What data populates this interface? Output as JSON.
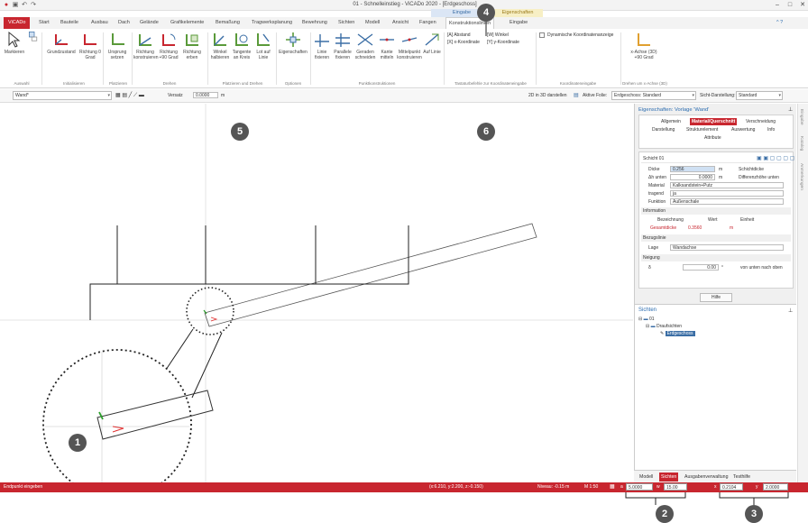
{
  "window": {
    "title": "01 - Schnelleinstieg - ViCADo 2020 - [Erdgeschoss]",
    "context_group_1": "Eingabe",
    "context_group_2": "Eigenschaften"
  },
  "tabs": [
    "ViCADo",
    "Start",
    "Bauteile",
    "Ausbau",
    "Dach",
    "Gelände",
    "Grafikelemente",
    "Bemaßung",
    "Tragwerksplanung",
    "Bewehrung",
    "Sichten",
    "Modell",
    "Ansicht",
    "Fangen",
    "Konstruktionslinien",
    "Eingabe"
  ],
  "ribbon": {
    "auswahl": {
      "markieren": "Markieren",
      "group": "Auswahl"
    },
    "initialisieren": {
      "grundzustand": "Grundzustand",
      "richtung_0": "Richtung 0 Grad",
      "group": "Initialisieren"
    },
    "platzieren": {
      "ursprung": "Ursprung setzen",
      "group": "Platzieren"
    },
    "drehen": {
      "richtung_konstruieren": "Richtung konstruieren",
      "richtung_90": "Richtung +90 Grad",
      "richtung_erben": "Richtung erben",
      "group": "Drehen"
    },
    "platzieren_drehen": {
      "winkel": "Winkel halbieren",
      "tangente": "Tangente an Kreis",
      "lot": "Lot auf Linie",
      "group": "Platzieren und Drehen"
    },
    "optionen": {
      "eigenschaften": "Eigenschaften",
      "group": "Optionen"
    },
    "punkte": {
      "linie": "Linie fixieren",
      "parallele": "Parallele fixieren",
      "geraden": "Geraden schneiden",
      "kante": "Kante mitteln",
      "mittelpunkt": "Mittelpunkt konstruieren",
      "auf_linie": "Auf Linie",
      "group": "Punktkonstruktionen"
    },
    "tastatur": {
      "abstand": "[A] Abstand",
      "winkel": "[W] Winkel",
      "xk": "[X] x-Koordinate",
      "yk": "[Y] y-Koordinate",
      "group": "Tastaturbefehle zur Koordinateneingabe"
    },
    "koordinaten": {
      "dynamische": "Dynamische Koordinatenanzeige",
      "group": "Koordinateneingabe"
    },
    "achse": {
      "x_achse": "x-Achse (3D)",
      "plus90": "+90 Grad",
      "group": "Drehen um x-Achse (3D)"
    }
  },
  "optionbar": {
    "object": "Wand*",
    "versatz_label": "Versatz",
    "versatz_value": "0.0000",
    "unit": "m",
    "btn_3d": "2D in 3D darstellen",
    "aktive_folie_label": "Aktive Folie:",
    "aktive_folie_value": "Erdgeschoss: Standard",
    "sicht_label": "Sicht-Darstellung:",
    "sicht_value": "Standard"
  },
  "panel": {
    "title": "Eigenschaften: Vorlage 'Wand'",
    "tabs1": [
      "Allgemein",
      "Material/Querschnitt",
      "Verschneidung"
    ],
    "tabs2": [
      "Darstellung",
      "Strukturelement",
      "Auswertung",
      "Info"
    ],
    "tabs3": [
      "Attribute"
    ],
    "schicht": "Schicht 01",
    "rows": [
      {
        "label": "Dicke",
        "value": "0.256",
        "unit": "m",
        "note": "Schichtdicke"
      },
      {
        "label": "Δh unten",
        "value": "0.0000",
        "unit": "m",
        "note": "Differenzhöhe unten"
      },
      {
        "label": "Material",
        "value": "Kalksandstein+Putz",
        "unit": "",
        "note": ""
      },
      {
        "label": "tragend",
        "value": "ja",
        "unit": "",
        "note": ""
      },
      {
        "label": "Funktion",
        "value": "Außenschale",
        "unit": "",
        "note": ""
      }
    ],
    "info_title": "Information",
    "info_headers": [
      "Bezeichnung",
      "Wert",
      "Einheit"
    ],
    "info_row": [
      "Gesamtdicke",
      "0.3560",
      "m"
    ],
    "bezug_title": "Bezugslinie",
    "lage_label": "Lage",
    "lage_value": "Wandachse",
    "neigung_title": "Neigung",
    "neigung_label": "δ",
    "neigung_value": "0.00",
    "neigung_unit": "°",
    "neigung_note": "von unten nach oben",
    "hilfe": "Hilfe"
  },
  "sichten": {
    "title": "Sichten",
    "root": "01",
    "child": "Draufsichten",
    "leaf": "Erdgeschoss"
  },
  "sidetabs": [
    "Eingabe",
    "Katalog",
    "Anmerkungen"
  ],
  "bottom_tabs": [
    "Modell",
    "Sichten",
    "Ausgabenverwaltung",
    "Testhilfe"
  ],
  "status": {
    "prompt": "Endpunkt eingeben",
    "coords": "(x:6.210, y:2.200, z:-0.150)",
    "niveau": "Niveau: -0.15 m",
    "massstab": "M 1:50",
    "a_value": "5.0000",
    "w_value": "15.00",
    "x_value": "0.2104",
    "y_value": "2.0000"
  },
  "callouts": [
    "1",
    "2",
    "3",
    "4",
    "5",
    "6"
  ]
}
